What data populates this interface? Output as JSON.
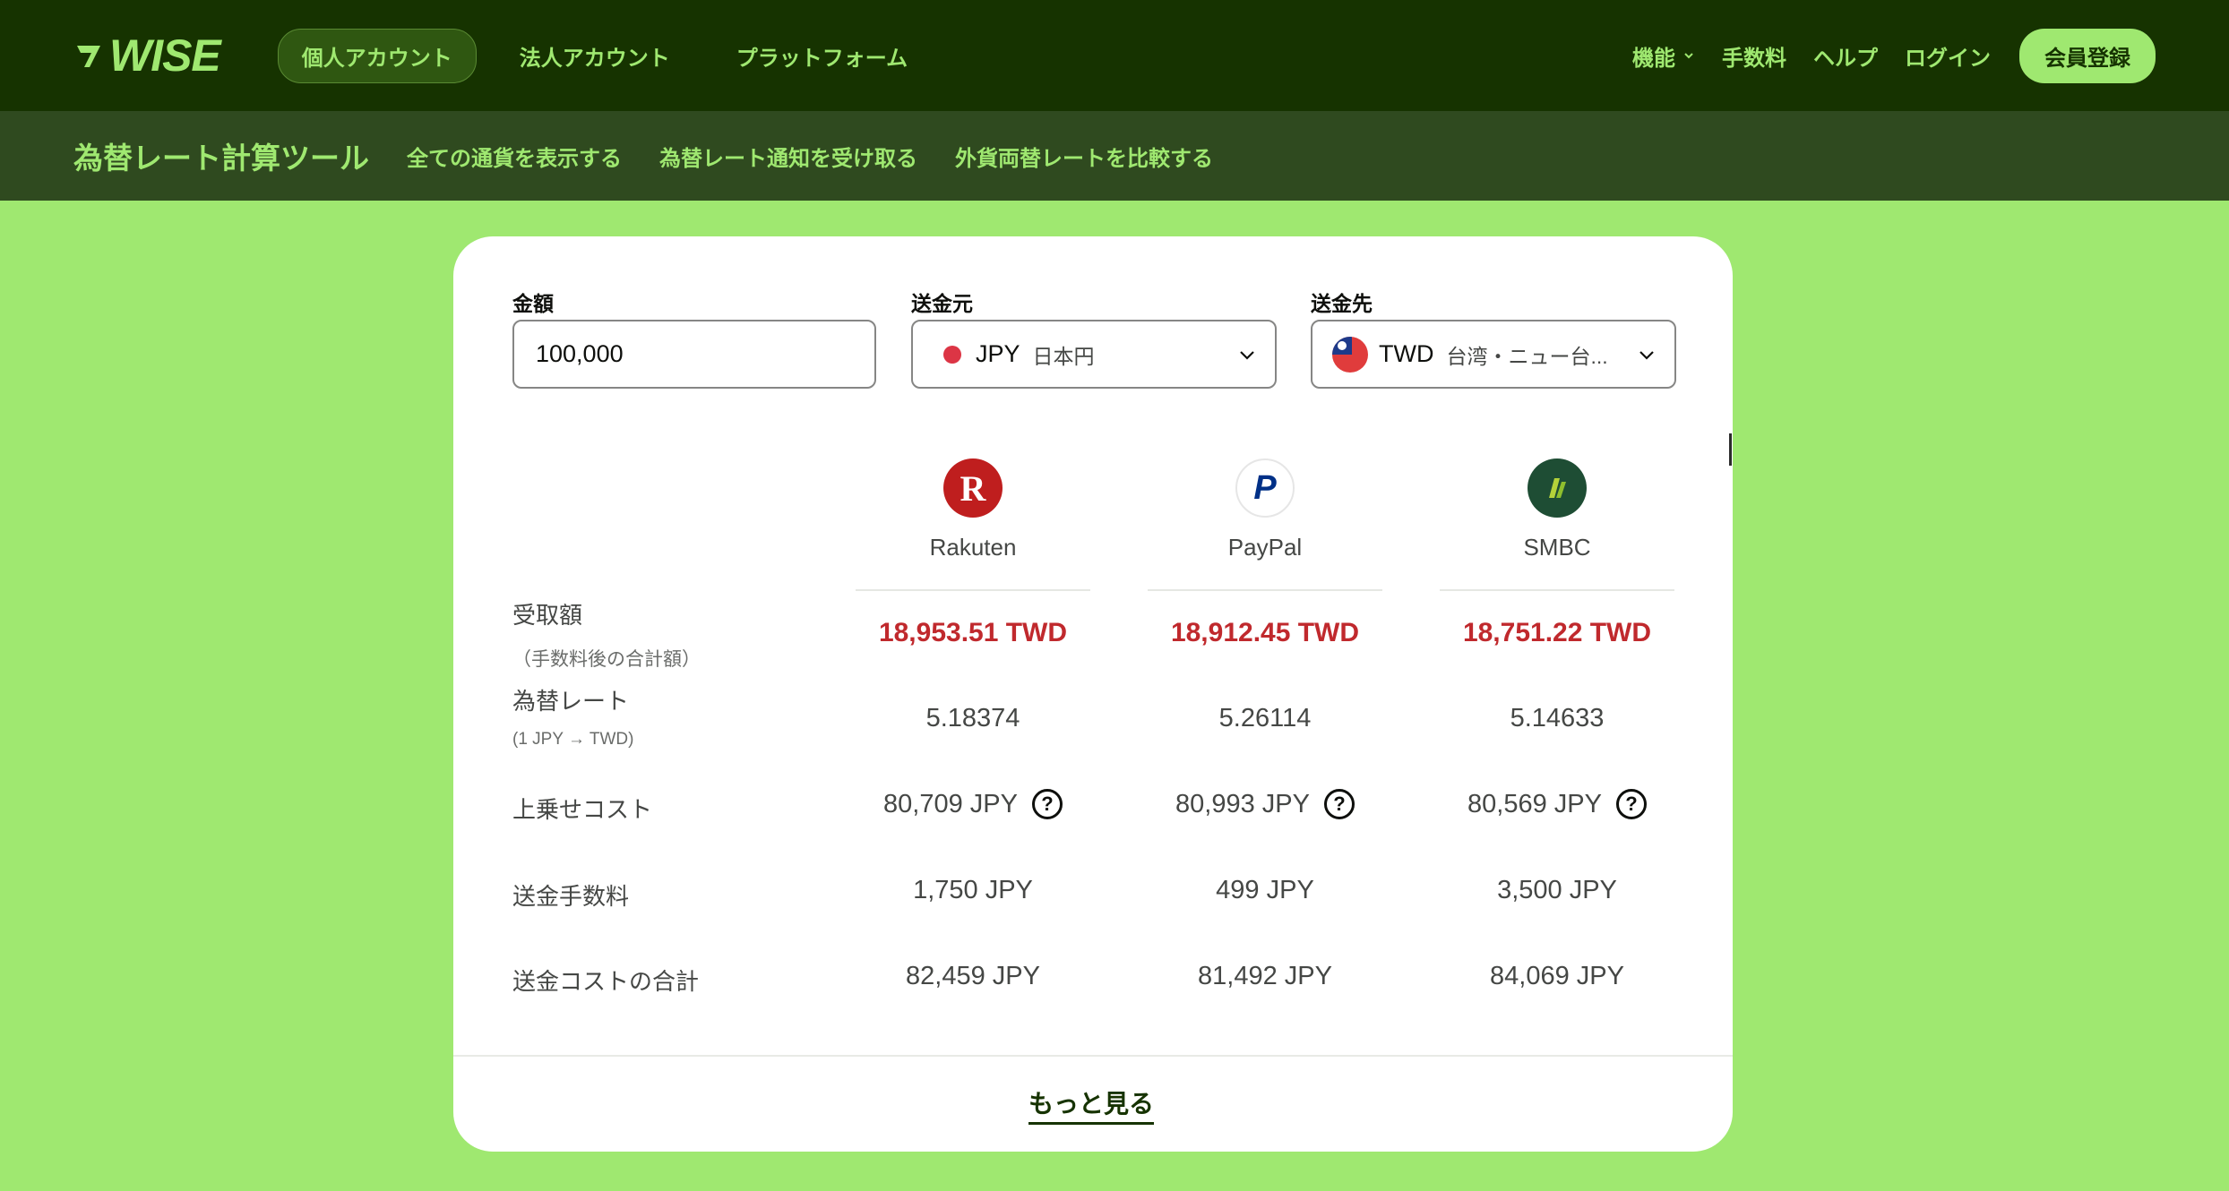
{
  "topnav": {
    "logo_text": "WISE",
    "left_items": [
      "個人アカウント",
      "法人アカウント",
      "プラットフォーム"
    ],
    "right_items": [
      "機能",
      "手数料",
      "ヘルプ",
      "ログイン"
    ],
    "signup_label": "会員登録"
  },
  "subnav": {
    "title": "為替レート計算ツール",
    "links": [
      "全ての通貨を表示する",
      "為替レート通知を受け取る",
      "外貨両替レートを比較する"
    ]
  },
  "form": {
    "amount_label": "金額",
    "amount_value": "100,000",
    "from_label": "送金元",
    "from_code": "JPY",
    "from_name": "日本円",
    "to_label": "送金先",
    "to_code": "TWD",
    "to_name": "台湾・ニュー台..."
  },
  "providers": [
    {
      "name": "Rakuten",
      "logo_letter": "R",
      "received": "18,953.51 TWD",
      "rate": "5.18374",
      "markup": "80,709 JPY",
      "fee": "1,750 JPY",
      "total": "82,459 JPY"
    },
    {
      "name": "PayPal",
      "logo_letter": "P",
      "received": "18,912.45 TWD",
      "rate": "5.26114",
      "markup": "80,993 JPY",
      "fee": "499 JPY",
      "total": "81,492 JPY"
    },
    {
      "name": "SMBC",
      "logo_letter": "",
      "received": "18,751.22 TWD",
      "rate": "5.14633",
      "markup": "80,569 JPY",
      "fee": "3,500 JPY",
      "total": "84,069 JPY"
    }
  ],
  "rows": {
    "received_label": "受取額",
    "received_sub": "（手数料後の合計額）",
    "rate_label": "為替レート",
    "rate_sub": "(1 JPY → TWD)",
    "markup_label": "上乗せコスト",
    "fee_label": "送金手数料",
    "total_label": "送金コストの合計"
  },
  "help_glyph": "?",
  "more_label": "もっと見る",
  "colors": {
    "brand_dark": "#163300",
    "brand_green": "#9fe870",
    "amount_red": "#c0292d"
  }
}
